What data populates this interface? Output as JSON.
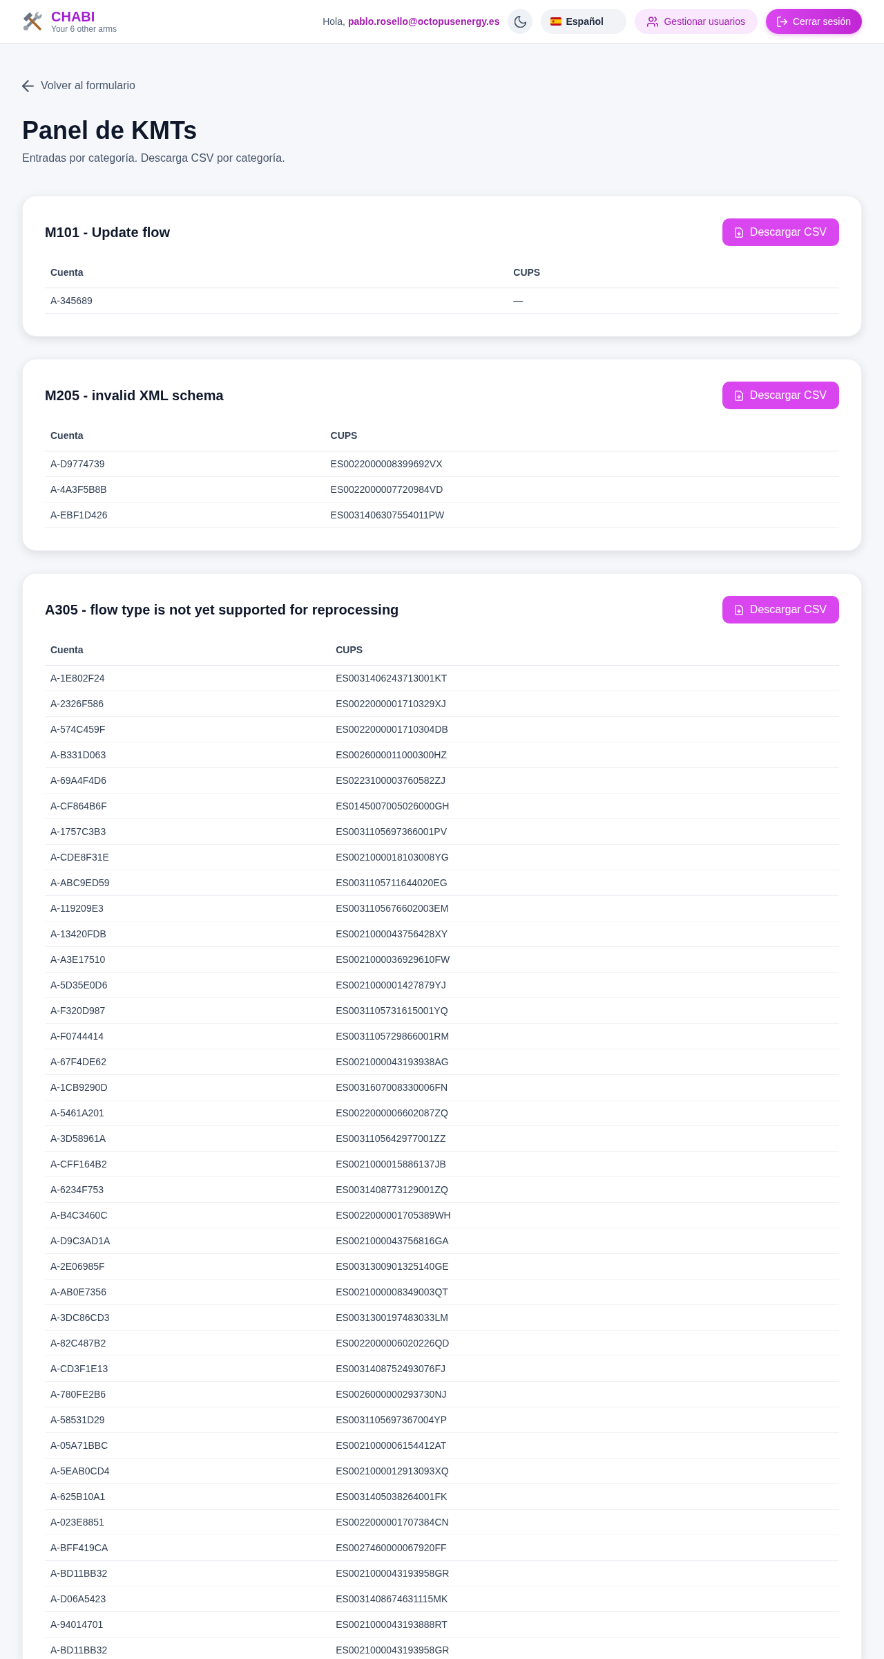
{
  "header": {
    "brand": {
      "name": "CHABI",
      "tagline": "Your 6 other arms"
    },
    "greeting": {
      "prefix": "Hola,",
      "email": "pablo.rosello@octopusenergy.es"
    },
    "language": "Español",
    "buttons": [
      {
        "kind": "manage",
        "label": "Gestionar usuarios"
      },
      {
        "kind": "logout",
        "label": "Cerrar sesión"
      }
    ]
  },
  "back_link": "Volver al formulario",
  "page": {
    "title": "Panel de KMTs",
    "subtitle": "Entradas por categoría. Descarga CSV por categoría."
  },
  "categories": [
    {
      "title": "M101 - Update flow",
      "button": "Descargar CSV",
      "columns": [
        "Cuenta",
        "CUPS"
      ],
      "rows": [
        [
          "A-345689",
          "—"
        ]
      ]
    },
    {
      "title": "M205 - invalid XML schema",
      "button": "Descargar CSV",
      "columns": [
        "Cuenta",
        "CUPS"
      ],
      "rows": [
        [
          "A-D9774739",
          "ES0022000008399692VX"
        ],
        [
          "A-4A3F5B8B",
          "ES0022000007720984VD"
        ],
        [
          "A-EBF1D426",
          "ES0031406307554011PW"
        ]
      ]
    },
    {
      "title": "A305 - flow type is not yet supported for reprocessing",
      "button": "Descargar CSV",
      "columns": [
        "Cuenta",
        "CUPS"
      ],
      "rows": [
        [
          "A-1E802F24",
          "ES0031406243713001KT"
        ],
        [
          "A-2326F586",
          "ES0022000001710329XJ"
        ],
        [
          "A-574C459F",
          "ES0022000001710304DB"
        ],
        [
          "A-B331D063",
          "ES0026000011000300HZ"
        ],
        [
          "A-69A4F4D6",
          "ES0223100003760582ZJ"
        ],
        [
          "A-CF864B6F",
          "ES0145007005026000GH"
        ],
        [
          "A-1757C3B3",
          "ES0031105697366001PV"
        ],
        [
          "A-CDE8F31E",
          "ES0021000018103008YG"
        ],
        [
          "A-ABC9ED59",
          "ES0031105711644020EG"
        ],
        [
          "A-119209E3",
          "ES0031105676602003EM"
        ],
        [
          "A-13420FDB",
          "ES0021000043756428XY"
        ],
        [
          "A-A3E17510",
          "ES0021000036929610FW"
        ],
        [
          "A-5D35E0D6",
          "ES0021000001427879YJ"
        ],
        [
          "A-F320D987",
          "ES0031105731615001YQ"
        ],
        [
          "A-F0744414",
          "ES0031105729866001RM"
        ],
        [
          "A-67F4DE62",
          "ES0021000043193938AG"
        ],
        [
          "A-1CB9290D",
          "ES0031607008330006FN"
        ],
        [
          "A-5461A201",
          "ES0022000006602087ZQ"
        ],
        [
          "A-3D58961A",
          "ES0031105642977001ZZ"
        ],
        [
          "A-CFF164B2",
          "ES0021000015886137JB"
        ],
        [
          "A-6234F753",
          "ES0031408773129001ZQ"
        ],
        [
          "A-B4C3460C",
          "ES0022000001705389WH"
        ],
        [
          "A-D9C3AD1A",
          "ES0021000043756816GA"
        ],
        [
          "A-2E06985F",
          "ES0031300901325140GE"
        ],
        [
          "A-AB0E7356",
          "ES0021000008349003QT"
        ],
        [
          "A-3DC86CD3",
          "ES0031300197483033LM"
        ],
        [
          "A-82C487B2",
          "ES0022000006020226QD"
        ],
        [
          "A-CD3F1E13",
          "ES0031408752493076FJ"
        ],
        [
          "A-780FE2B6",
          "ES0026000000293730NJ"
        ],
        [
          "A-58531D29",
          "ES0031105697367004YP"
        ],
        [
          "A-05A71BBC",
          "ES0021000006154412AT"
        ],
        [
          "A-5EAB0CD4",
          "ES0021000012913093XQ"
        ],
        [
          "A-625B10A1",
          "ES0031405038264001FK"
        ],
        [
          "A-023E8851",
          "ES0022000001707384CN"
        ],
        [
          "A-BFF419CA",
          "ES0027460000067920FF"
        ],
        [
          "A-BD11BB32",
          "ES0021000043193958GR"
        ],
        [
          "A-D06A5423",
          "ES0031408674631115MK"
        ],
        [
          "A-94014701",
          "ES0021000043193888RT"
        ],
        [
          "A-BD11BB32",
          "ES0021000043193958GR"
        ]
      ]
    }
  ]
}
